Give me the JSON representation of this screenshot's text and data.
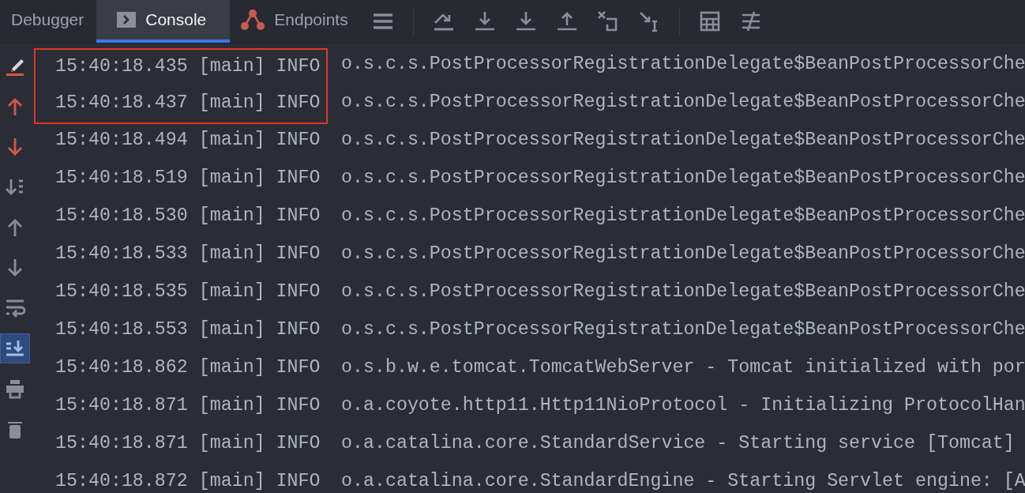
{
  "tabs": [
    {
      "label": "Debugger",
      "kind": "plain",
      "selected": false
    },
    {
      "label": "Console",
      "kind": "console",
      "selected": true
    },
    {
      "label": "Endpoints",
      "kind": "endpoints",
      "selected": false
    }
  ],
  "side_toolbar": [
    {
      "kind": "soft-wrap-clear",
      "selected": false
    },
    {
      "kind": "up-red",
      "selected": false
    },
    {
      "kind": "down-red",
      "selected": false
    },
    {
      "kind": "sort",
      "selected": false
    },
    {
      "kind": "up",
      "selected": false
    },
    {
      "kind": "down",
      "selected": false
    },
    {
      "kind": "wrap",
      "selected": false
    },
    {
      "kind": "scroll-end",
      "selected": true
    },
    {
      "kind": "print",
      "selected": false
    },
    {
      "kind": "trash",
      "selected": false
    }
  ],
  "log": [
    {
      "prefix": "15:40:18.435 [main] INFO",
      "message": "o.s.c.s.PostProcessorRegistrationDelegate$BeanPostProcessorChe",
      "highlighted": true
    },
    {
      "prefix": "15:40:18.437 [main] INFO",
      "message": "o.s.c.s.PostProcessorRegistrationDelegate$BeanPostProcessorChe",
      "highlighted": true
    },
    {
      "prefix": "15:40:18.494 [main] INFO",
      "message": "o.s.c.s.PostProcessorRegistrationDelegate$BeanPostProcessorChe",
      "highlighted": false
    },
    {
      "prefix": "15:40:18.519 [main] INFO",
      "message": "o.s.c.s.PostProcessorRegistrationDelegate$BeanPostProcessorChe",
      "highlighted": false
    },
    {
      "prefix": "15:40:18.530 [main] INFO",
      "message": "o.s.c.s.PostProcessorRegistrationDelegate$BeanPostProcessorChe",
      "highlighted": false
    },
    {
      "prefix": "15:40:18.533 [main] INFO",
      "message": "o.s.c.s.PostProcessorRegistrationDelegate$BeanPostProcessorChe",
      "highlighted": false
    },
    {
      "prefix": "15:40:18.535 [main] INFO",
      "message": "o.s.c.s.PostProcessorRegistrationDelegate$BeanPostProcessorChe",
      "highlighted": false
    },
    {
      "prefix": "15:40:18.553 [main] INFO",
      "message": "o.s.c.s.PostProcessorRegistrationDelegate$BeanPostProcessorChe",
      "highlighted": false
    },
    {
      "prefix": "15:40:18.862 [main] INFO",
      "message": "o.s.b.w.e.tomcat.TomcatWebServer - Tomcat initialized with por",
      "highlighted": false
    },
    {
      "prefix": "15:40:18.871 [main] INFO",
      "message": "o.a.coyote.http11.Http11NioProtocol - Initializing ProtocolHan",
      "highlighted": false
    },
    {
      "prefix": "15:40:18.871 [main] INFO",
      "message": "o.a.catalina.core.StandardService - Starting service [Tomcat]",
      "highlighted": false
    },
    {
      "prefix": "15:40:18.872 [main] INFO",
      "message": "o.a.catalina.core.StandardEngine - Starting Servlet engine: [A",
      "highlighted": false
    }
  ]
}
